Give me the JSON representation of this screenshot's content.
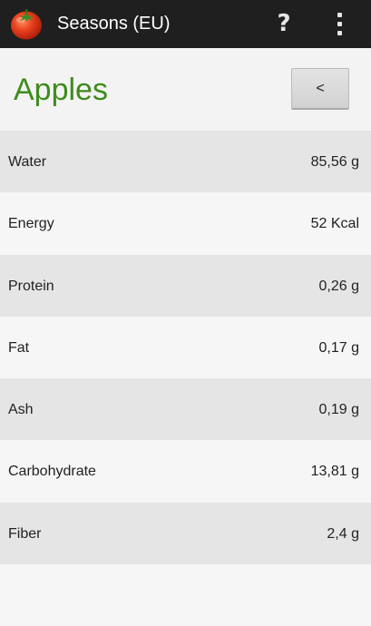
{
  "action_bar": {
    "title": "Seasons (EU)",
    "help_label": "?",
    "app_icon": "tomato-icon",
    "overflow_icon": "overflow-menu-icon",
    "background": "#1f1f1f"
  },
  "header": {
    "title": "Apples",
    "back_label": "<",
    "title_color": "#3f8b1c"
  },
  "nutrients": [
    {
      "label": "Water",
      "value": "85,56 g"
    },
    {
      "label": "Energy",
      "value": "52 Kcal"
    },
    {
      "label": "Protein",
      "value": "0,26 g"
    },
    {
      "label": "Fat",
      "value": "0,17 g"
    },
    {
      "label": "Ash",
      "value": "0,19 g"
    },
    {
      "label": "Carbohydrate",
      "value": "13,81 g"
    },
    {
      "label": "Fiber",
      "value": "2,4 g"
    }
  ]
}
